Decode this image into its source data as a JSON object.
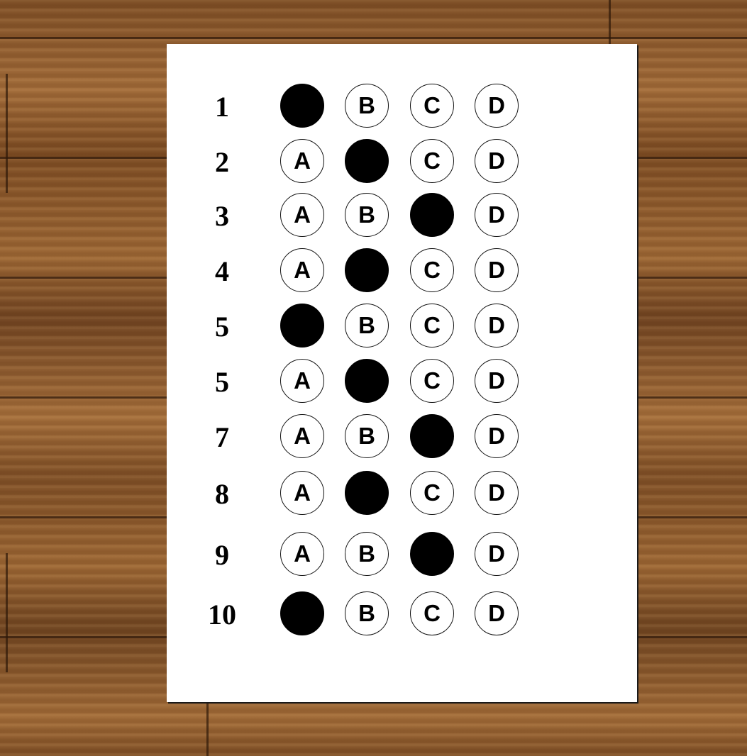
{
  "answer_sheet": {
    "options": [
      "A",
      "B",
      "C",
      "D"
    ],
    "questions": [
      {
        "number": "1",
        "filled": "A"
      },
      {
        "number": "2",
        "filled": "B"
      },
      {
        "number": "3",
        "filled": "C"
      },
      {
        "number": "4",
        "filled": "B"
      },
      {
        "number": "5",
        "filled": "A"
      },
      {
        "number": "5",
        "filled": "B"
      },
      {
        "number": "7",
        "filled": "C"
      },
      {
        "number": "8",
        "filled": "B"
      },
      {
        "number": "9",
        "filled": "C"
      },
      {
        "number": "10",
        "filled": "A"
      }
    ]
  },
  "colors": {
    "paper": "#ffffff",
    "ink": "#000000",
    "wood": "#8a5a2e"
  }
}
